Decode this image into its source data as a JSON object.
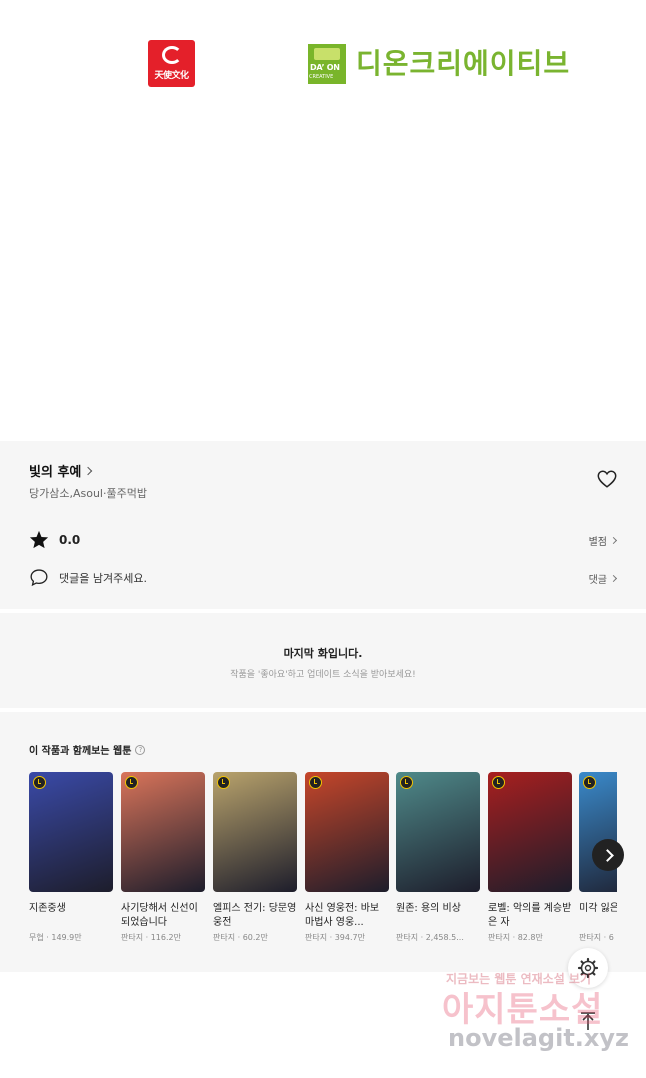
{
  "logos": {
    "angel": "天使文化",
    "daon_badge": "DA’ ON",
    "daon_badge_sub": "CREATIVE",
    "daon_name": "디온크리에이티브"
  },
  "work": {
    "title": "빛의 후예",
    "authors": "당가삼소,Asoul·풀주먹밥",
    "rating": "0.0",
    "rating_link": "별점",
    "comment_prompt": "댓글을 남겨주세요.",
    "comment_link": "댓글"
  },
  "last_episode": {
    "title": "마지막 화입니다.",
    "subtitle": "작품을 '좋아요'하고 업데이트 소식을 받아보세요!"
  },
  "recommendations": {
    "heading": "이 작품과 함께보는 웹툰",
    "help": "?",
    "items": [
      {
        "title": "지존중생",
        "meta": "무협 · 149.9만",
        "color": "#3a4aa8"
      },
      {
        "title": "사기당해서 신선이 되었습니다",
        "meta": "판타지 · 116.2만",
        "color": "#d9745a"
      },
      {
        "title": "엘피스 전기: 당문영웅전",
        "meta": "판타지 · 60.2만",
        "color": "#b9a36c"
      },
      {
        "title": "사신 영웅전: 바보 마법사 영웅...",
        "meta": "판타지 · 394.7만",
        "color": "#c6462a"
      },
      {
        "title": "원존: 용의 비상",
        "meta": "판타지 · 2,458.5...",
        "color": "#4f8a8a"
      },
      {
        "title": "로벨: 악의를 계승받은 자",
        "meta": "판타지 · 82.8만",
        "color": "#a81f1f"
      },
      {
        "title": "미각 잃은 요리사!",
        "meta": "판타지 · 6",
        "color": "#3a8acb"
      }
    ]
  },
  "watermark": {
    "top": "지금보는 웹툰 연재소설 보기",
    "big": "아지툰소설",
    "url": "novelagit.xyz"
  }
}
